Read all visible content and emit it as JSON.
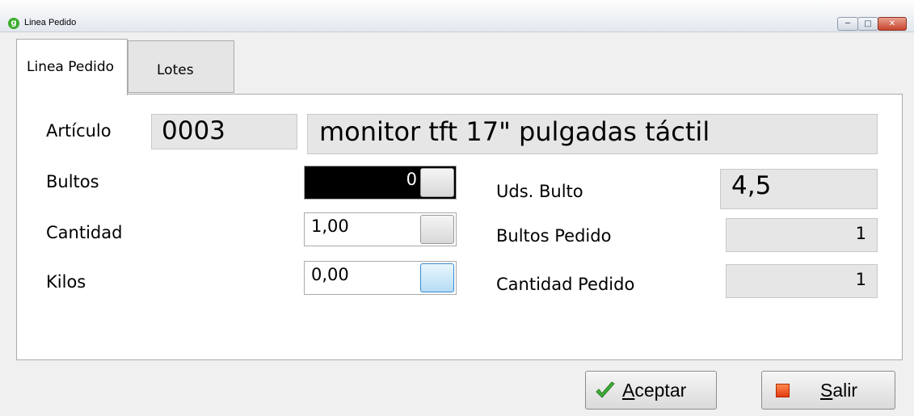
{
  "window": {
    "title": "Linea Pedido",
    "icon": "app-logo-icon",
    "controls": [
      "minimize-icon",
      "maximize-icon",
      "close-icon"
    ]
  },
  "tabs": [
    {
      "label": "Linea Pedido",
      "active": true
    },
    {
      "label": "Lotes",
      "active": false
    }
  ],
  "articulo": {
    "label": "Artículo",
    "code": "0003",
    "description": "monitor tft 17\" pulgadas táctil"
  },
  "bultos": {
    "label": "Bultos",
    "value": "0"
  },
  "cantidad": {
    "label": "Cantidad",
    "value": "1,00"
  },
  "kilos": {
    "label": "Kilos",
    "value": "0,00"
  },
  "uds_bulto": {
    "label": "Uds. Bulto",
    "value": "4,5"
  },
  "bultos_pedido": {
    "label": "Bultos Pedido",
    "value": "1"
  },
  "cantidad_pedido": {
    "label": "Cantidad Pedido",
    "value": "1"
  },
  "buttons": {
    "aceptar": {
      "mnemonic": "A",
      "rest": "ceptar",
      "icon": "checkmark-icon"
    },
    "salir": {
      "mnemonic": "S",
      "rest": "alir",
      "icon": "stop-icon"
    }
  }
}
